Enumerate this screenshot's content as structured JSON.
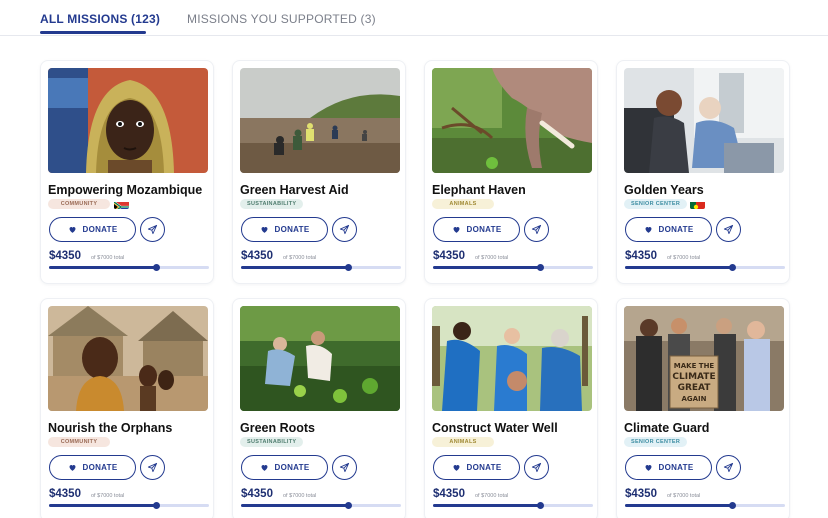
{
  "tabs": [
    {
      "label": "ALL MISSIONS (123)",
      "active": true
    },
    {
      "label": "MISSIONS YOU SUPPORTED (3)",
      "active": false
    }
  ],
  "card_labels": {
    "donate": "DONATE"
  },
  "tag_colors": {
    "COMMUNITY": {
      "bg": "#f6e6df",
      "fg": "#9a6a55"
    },
    "SUSTAINABILITY": {
      "bg": "#e3efec",
      "fg": "#4f7d6f"
    },
    "ANIMALS": {
      "bg": "#f7f1d8",
      "fg": "#a08a35"
    },
    "SENIOR CENTER": {
      "bg": "#e2f1f6",
      "fg": "#3f8ea3"
    }
  },
  "missions": [
    {
      "title": "Empowering Mozambique",
      "tag": "COMMUNITY",
      "flag": "south-africa-flag",
      "raised": "$4350",
      "goal_text": "of $7000 total",
      "progress": 0.67,
      "image": "girl-headscarf-photo"
    },
    {
      "title": "Green Harvest Aid",
      "tag": "SUSTAINABILITY",
      "flag": null,
      "raised": "$4350",
      "goal_text": "of $7000 total",
      "progress": 0.67,
      "image": "beach-planting-photo"
    },
    {
      "title": "Elephant Haven",
      "tag": "ANIMALS",
      "flag": null,
      "raised": "$4350",
      "goal_text": "of $7000 total",
      "progress": 0.67,
      "image": "elephant-photo"
    },
    {
      "title": "Golden Years",
      "tag": "SENIOR CENTER",
      "flag": "portugal-flag",
      "raised": "$4350",
      "goal_text": "of $7000 total",
      "progress": 0.67,
      "image": "elderly-care-photo"
    },
    {
      "title": "Nourish the Orphans",
      "tag": "COMMUNITY",
      "flag": null,
      "raised": "$4350",
      "goal_text": "of $7000 total",
      "progress": 0.67,
      "image": "village-children-photo"
    },
    {
      "title": "Green Roots",
      "tag": "SUSTAINABILITY",
      "flag": null,
      "raised": "$4350",
      "goal_text": "of $7000 total",
      "progress": 0.67,
      "image": "garden-volunteers-photo"
    },
    {
      "title": "Construct Water Well",
      "tag": "ANIMALS",
      "flag": null,
      "raised": "$4350",
      "goal_text": "of $7000 total",
      "progress": 0.67,
      "image": "volunteers-huddle-photo"
    },
    {
      "title": "Climate Guard",
      "tag": "SENIOR CENTER",
      "flag": null,
      "raised": "$4350",
      "goal_text": "of $7000 total",
      "progress": 0.67,
      "image": "climate-protest-photo"
    }
  ],
  "sign_text": [
    "MAKE THE",
    "CLIMATE",
    "GREAT",
    "AGAIN"
  ]
}
